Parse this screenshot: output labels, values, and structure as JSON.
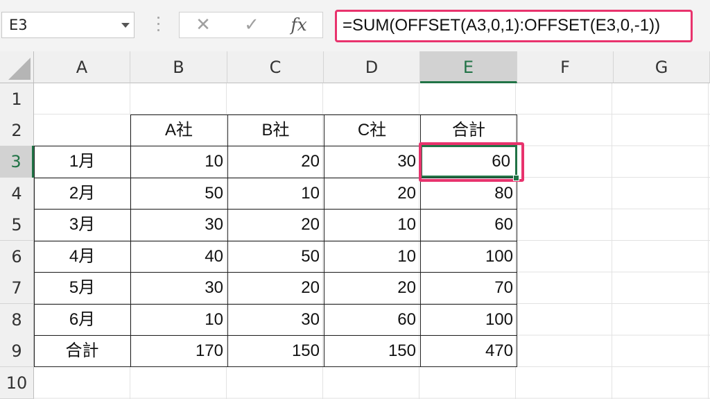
{
  "namebox": {
    "value": "E3"
  },
  "formula_bar": {
    "cancel_icon": "✕",
    "enter_icon": "✓",
    "fx_label": "fx",
    "formula": "=SUM(OFFSET(A3,0,1):OFFSET(E3,0,-1))"
  },
  "columns": [
    "A",
    "B",
    "C",
    "D",
    "E",
    "F",
    "G"
  ],
  "rows": [
    "1",
    "2",
    "3",
    "4",
    "5",
    "6",
    "7",
    "8",
    "9",
    "10"
  ],
  "table": {
    "headers": [
      "A社",
      "B社",
      "C社",
      "合計"
    ],
    "rows": [
      {
        "label": "1月",
        "values": [
          "10",
          "20",
          "30",
          "60"
        ]
      },
      {
        "label": "2月",
        "values": [
          "50",
          "10",
          "20",
          "80"
        ]
      },
      {
        "label": "3月",
        "values": [
          "30",
          "20",
          "10",
          "60"
        ]
      },
      {
        "label": "4月",
        "values": [
          "40",
          "50",
          "10",
          "100"
        ]
      },
      {
        "label": "5月",
        "values": [
          "30",
          "20",
          "20",
          "70"
        ]
      },
      {
        "label": "6月",
        "values": [
          "10",
          "30",
          "60",
          "100"
        ]
      },
      {
        "label": "合計",
        "values": [
          "170",
          "150",
          "150",
          "470"
        ]
      }
    ]
  },
  "selected_cell": "E3",
  "colors": {
    "accent": "#217346",
    "highlight": "#e8336d"
  }
}
